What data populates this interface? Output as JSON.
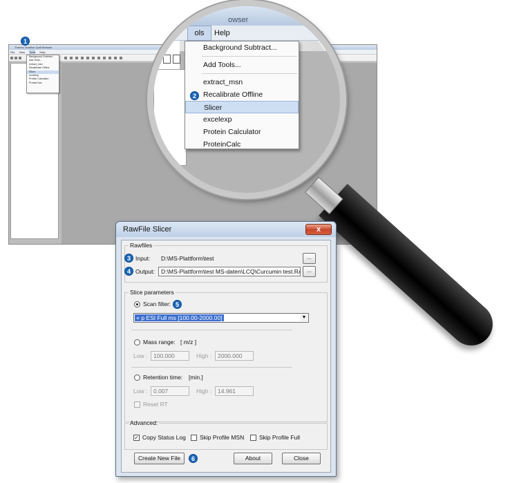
{
  "background_app": {
    "title": "Thermo Xcalibur Qual Browser",
    "menu": [
      "File",
      "View",
      "Tools",
      "Help"
    ],
    "tools_menu_items": [
      "Background Subtract...",
      "Add Tools...",
      "extract_msn",
      "Recalibrate Offline",
      "Slicer",
      "excelexp",
      "Protein Calculator",
      "ProteinCalc"
    ]
  },
  "magnifier": {
    "menubar": {
      "tools": "ols",
      "help": "Help"
    },
    "title_fragment": "owser",
    "items": [
      {
        "label": "Background Subtract..."
      },
      {
        "label": "Add Tools..."
      },
      {
        "label": "extract_msn"
      },
      {
        "label": "Recalibrate Offline"
      },
      {
        "label": "Slicer",
        "selected": true
      },
      {
        "label": "excelexp"
      },
      {
        "label": "Protein Calculator"
      },
      {
        "label": "ProteinCalc"
      }
    ]
  },
  "badges": [
    "1",
    "2",
    "3",
    "4",
    "5",
    "6"
  ],
  "dialog": {
    "title": "RawFile Slicer",
    "close_glyph": "x",
    "rawfiles": {
      "legend": "Rawfiles",
      "input_label": "Input:",
      "input_value": "D:\\MS-Plattform\\test",
      "output_label": "Output:",
      "output_value": "D:\\MS-Plattform\\test MS-daten\\LCQ\\Curcumin test.RA",
      "browse": "..."
    },
    "slice": {
      "legend": "Slice parameters",
      "scan_filter_label": "Scan filter:",
      "scan_filter_value": "+ p ESI Full ms [100.00-2000.00]",
      "mass_range_label": "Mass range:",
      "mass_range_unit": "[ m/z ]",
      "low_label": "Low :",
      "high_label": "High :",
      "mass_low": "100.000",
      "mass_high": "2000.000",
      "rt_label": "Retention time:",
      "rt_unit": "[min.]",
      "rt_low": "0.007",
      "rt_high": "14.961",
      "reset_rt": "Reset RT"
    },
    "advanced": {
      "legend": "Advanced:",
      "copy_status_log": "Copy Status Log",
      "skip_profile_msn": "Skip Profile MSN",
      "skip_profile_full": "Skip Profile Full"
    },
    "buttons": {
      "create": "Create New File",
      "about": "About",
      "close": "Close"
    }
  }
}
